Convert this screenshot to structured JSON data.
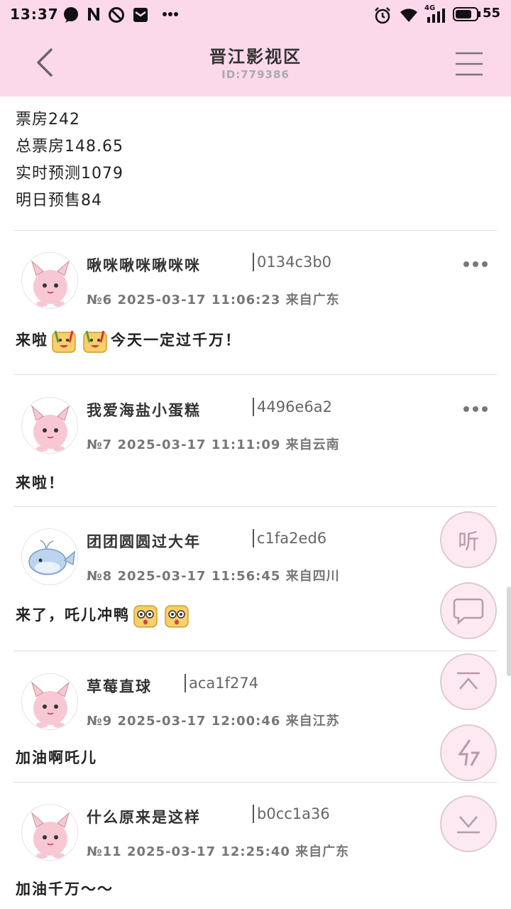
{
  "status_bar": {
    "time": "13:37",
    "network": "4G",
    "battery": "55"
  },
  "header": {
    "title": "晋江影视区",
    "subtitle": "ID:779386"
  },
  "stats": [
    "票房242",
    "总票房148.65",
    "实时预测1079",
    "明日预售84"
  ],
  "posts": [
    {
      "username": "啾咪啾咪啾咪咪",
      "user_id": "0134c3b0",
      "meta": "№6  2025-03-17  11:06:23  来自广东",
      "text_before": "来啦",
      "text_after": "今天一定过千万！"
    },
    {
      "username": "我爱海盐小蛋糕",
      "user_id": "4496e6a2",
      "meta": "№7  2025-03-17  11:11:09  来自云南",
      "text": "来啦！"
    },
    {
      "username": "团团圆圆过大年",
      "user_id": "c1fa2ed6",
      "meta": "№8  2025-03-17  11:56:45  来自四川",
      "text": "来了，吒儿冲鸭"
    },
    {
      "username": "草莓直球",
      "user_id": "aca1f274",
      "meta": "№9  2025-03-17  12:00:46  来自江苏",
      "text": "加油啊吒儿"
    },
    {
      "username": "什么原来是这样",
      "user_id": "b0cc1a36",
      "meta": "№11  2025-03-17  12:25:40  来自广东",
      "text": "加油千万～～"
    }
  ],
  "fabs": {
    "listen_label": "听"
  },
  "colors": {
    "header_bg": "#fcd9ea",
    "fab_bg": "#fde9f1",
    "fab_border": "#dfc8d2"
  },
  "icons": [
    "back-icon",
    "menu-icon",
    "more-icon",
    "comment-icon",
    "top-icon",
    "refresh-icon",
    "bottom-icon"
  ]
}
